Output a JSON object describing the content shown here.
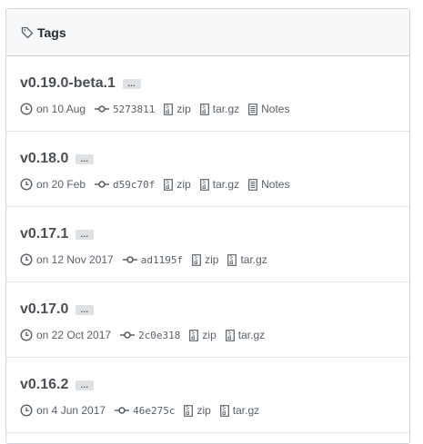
{
  "header": {
    "title": "Tags"
  },
  "tags": [
    {
      "name": "v0.19.0-beta.1",
      "ellipsis": "…",
      "date": "on 10 Aug",
      "commit": "5273811",
      "zip": "zip",
      "targz": "tar.gz",
      "notes": "Notes"
    },
    {
      "name": "v0.18.0",
      "ellipsis": "…",
      "date": "on 20 Feb",
      "commit": "d59c70f",
      "zip": "zip",
      "targz": "tar.gz",
      "notes": "Notes"
    },
    {
      "name": "v0.17.1",
      "ellipsis": "…",
      "date": "on 12 Nov 2017",
      "commit": "ad1195f",
      "zip": "zip",
      "targz": "tar.gz"
    },
    {
      "name": "v0.17.0",
      "ellipsis": "…",
      "date": "on 22 Oct 2017",
      "commit": "2c0e318",
      "zip": "zip",
      "targz": "tar.gz"
    },
    {
      "name": "v0.16.2",
      "ellipsis": "…",
      "date": "on 4 Jun 2017",
      "commit": "46e275c",
      "zip": "zip",
      "targz": "tar.gz"
    }
  ]
}
